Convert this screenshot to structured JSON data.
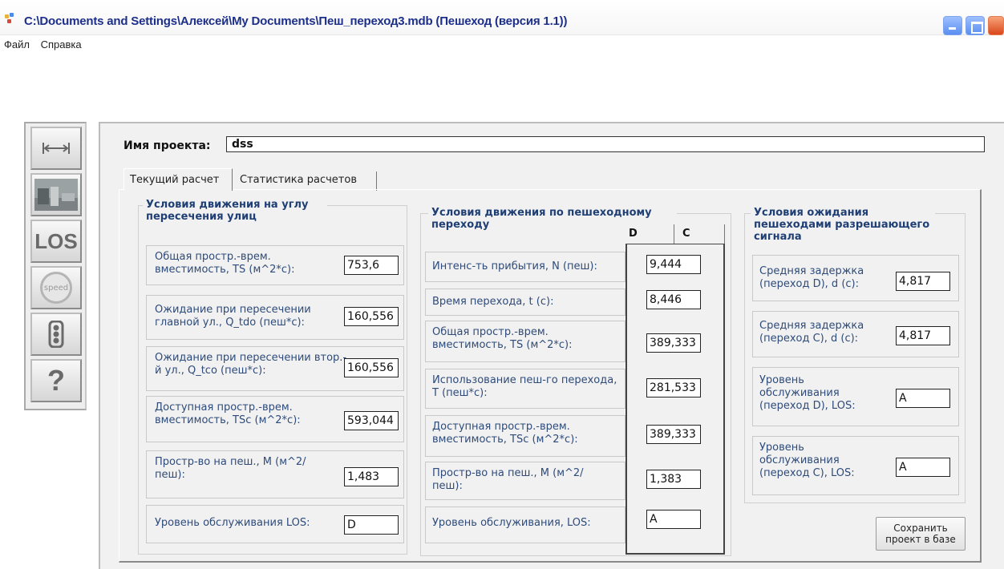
{
  "window": {
    "title": "C:\\Documents and Settings\\Алексей\\My Documents\\Пеш_переход3.mdb (Пешеход (версия 1.1))"
  },
  "menu": [
    "Файл",
    "Справка"
  ],
  "toolbar": {
    "los_label": "LOS",
    "speed_label": "speed",
    "help_label": "?"
  },
  "project": {
    "label": "Имя проекта:",
    "name": "dss"
  },
  "tabs": [
    "Текущий расчет",
    "Статистика расчетов"
  ],
  "corner": {
    "title": "Условия движения на углу пересечения улиц",
    "fields": [
      {
        "label": "Общая простр.-врем. вместимость, TS  (м^2*с):",
        "value": "753,6"
      },
      {
        "label": "Ожидание  при пересечении главной ул., Q_tdo (пеш*с):",
        "value": "160,556"
      },
      {
        "label": "Ожидание  при пересечении втор.-й ул., Q_tco (пеш*с):",
        "value": "160,556"
      },
      {
        "label": "Доступная простр.-врем. вместимость, TSc  (м^2*с):",
        "value": "593,044"
      },
      {
        "label": "Простр-во на пеш., М (м^2/пеш):",
        "value": "1,483"
      },
      {
        "label": "Уровень обслуживания LOS:",
        "value": "D"
      }
    ]
  },
  "crossing": {
    "title": "Условия движения по пешеходному переходу",
    "col_d": "D",
    "col_c": "C",
    "fields": [
      {
        "label": "Интенс-ть прибытия, N (пеш):",
        "value": "9,444"
      },
      {
        "label": "Время перехода, t  (с):",
        "value": "8,446"
      },
      {
        "label": "Общая простр.-врем. вместимость, TS  (м^2*с):",
        "value": "389,333"
      },
      {
        "label": "Использование пеш-го перехода, T (пеш*с):",
        "value": "281,533"
      },
      {
        "label": "Доступная простр.-врем. вместимость, TSc  (м^2*с):",
        "value": "389,333"
      },
      {
        "label": "Простр-во на пеш., М (м^2/пеш):",
        "value": "1,383"
      },
      {
        "label": "Уровень обслуживания, LOS:",
        "value": "A"
      }
    ]
  },
  "waiting": {
    "title": "Условия ожидания пешеходами разрешающего сигнала",
    "fields": [
      {
        "label": "Средняя задержка (переход D), d (с):",
        "value": "4,817"
      },
      {
        "label": "Средняя задержка (переход С), d (с):",
        "value": "4,817"
      },
      {
        "label": "Уровень обслуживания (переход D), LOS:",
        "value": "A"
      },
      {
        "label": "Уровень обслуживания (переход С), LOS:",
        "value": "A"
      }
    ]
  },
  "save_button": "Сохранить проект в базе",
  "colors": {
    "title_text": "#1c2f8a",
    "label_text": "#2e4b7a",
    "group_title": "#1f3f75",
    "panel_bg": "#f1f1f1"
  }
}
